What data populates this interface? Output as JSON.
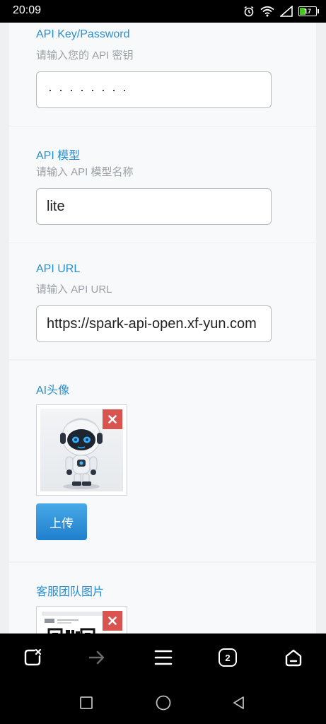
{
  "status_bar": {
    "time": "20:09",
    "battery_level": "17",
    "icons": [
      "alarm-icon",
      "wifi-icon",
      "signal-icon",
      "battery-icon"
    ]
  },
  "form": {
    "api_key": {
      "label": "API Key/Password",
      "hint": "请输入您的 API 密钥",
      "value": "········"
    },
    "api_model": {
      "label": "API 模型",
      "hint": "请输入 API 模型名称",
      "value": "lite"
    },
    "api_url": {
      "label": "API URL",
      "hint": "请输入 API URL",
      "value": "https://spark-api-open.xf-yun.com"
    },
    "ai_avatar": {
      "label": "AI头像",
      "upload_label": "上传"
    },
    "service_team_image": {
      "label": "客服团队图片"
    }
  },
  "browser_toolbar": {
    "tab_count": "2",
    "icons": [
      "close-tab-icon",
      "forward-arrow-icon",
      "menu-icon",
      "tabs-icon",
      "home-icon"
    ]
  },
  "system_nav": {
    "icons": [
      "recent-apps-icon",
      "home-circle-icon",
      "back-triangle-icon"
    ]
  },
  "colors": {
    "label_blue": "#2a8fd0",
    "upload_button": "#1f7fcd",
    "remove_red": "#d9534f"
  }
}
